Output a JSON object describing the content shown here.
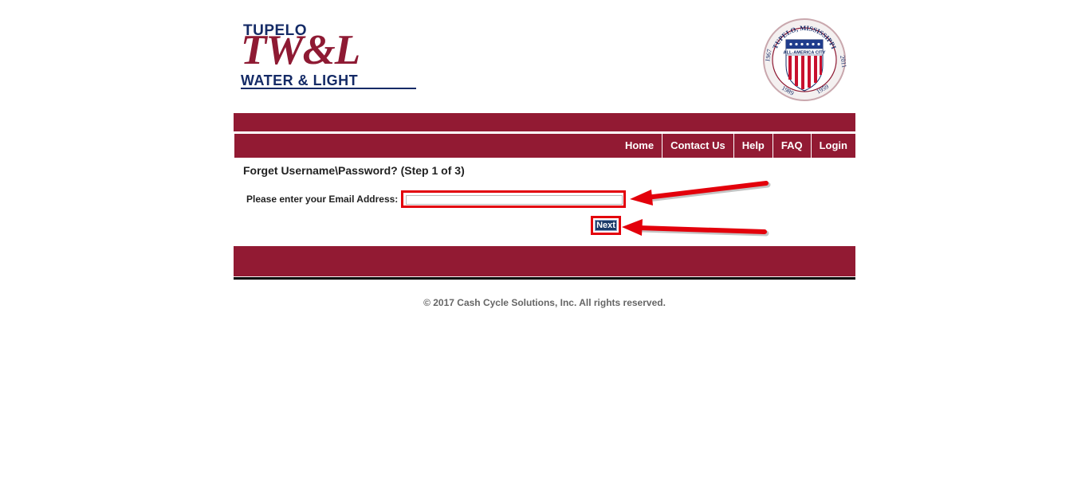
{
  "header": {
    "logo": {
      "line1": "TUPELO",
      "line2": "TW&L",
      "line3": "WATER & LIGHT"
    },
    "seal": {
      "top_text": "TUPELO, MISSISSIPPI",
      "center_text": "ALL-AMERICA CITY",
      "year_left": "1967",
      "year_right": "2011",
      "year_bl": "1989",
      "year_br": "1959"
    }
  },
  "nav": {
    "items": [
      {
        "label": "Home"
      },
      {
        "label": "Contact Us"
      },
      {
        "label": "Help"
      },
      {
        "label": "FAQ"
      },
      {
        "label": "Login"
      }
    ]
  },
  "form": {
    "title": "Forget Username\\Password? (Step 1 of 3)",
    "email_label": "Please enter your Email Address:",
    "email_value": "",
    "next_label": "Next"
  },
  "footer": {
    "copyright": "© 2017 Cash Cycle Solutions, Inc. All rights reserved."
  },
  "colors": {
    "brand_maroon": "#921a33",
    "logo_navy": "#142a66",
    "highlight_red": "#e3000b",
    "button_navy": "#1b3a69"
  }
}
